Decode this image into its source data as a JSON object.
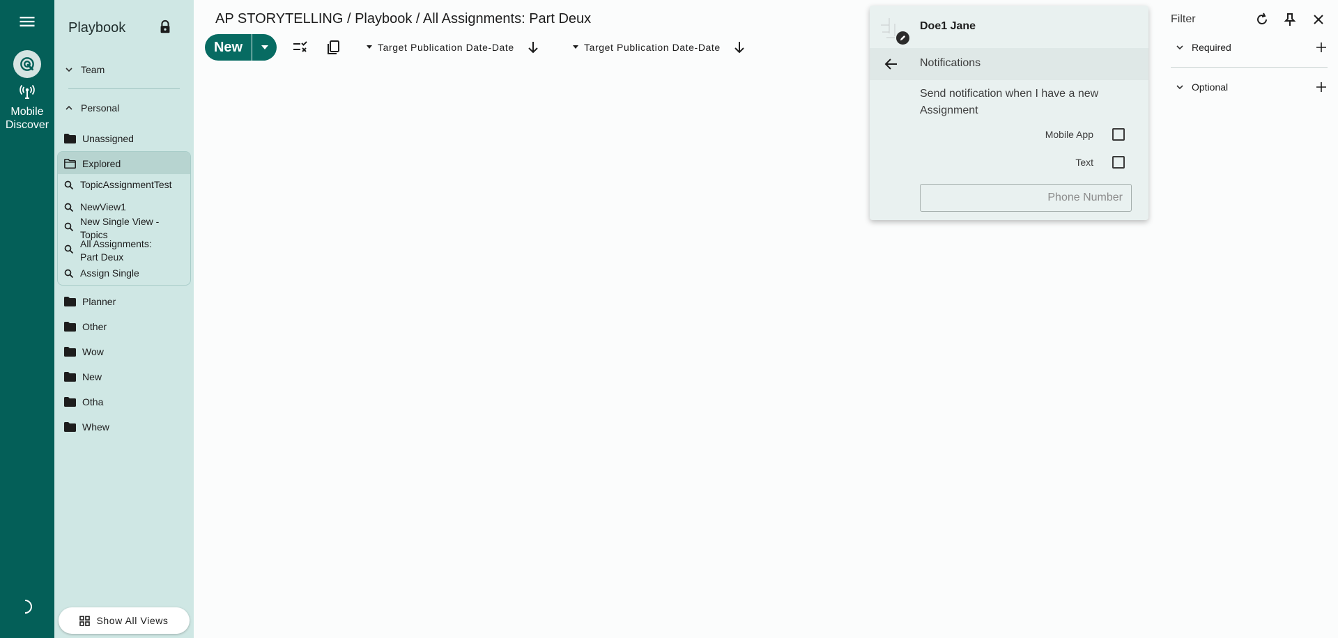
{
  "rail": {
    "label": "Mobile Discover",
    "icons": [
      "menu-icon",
      "discover-icon",
      "antenna-icon",
      "dark-mode-icon"
    ]
  },
  "sidebar": {
    "title": "Playbook",
    "sections": [
      {
        "label": "Team",
        "state": "collapsed"
      },
      {
        "label": "Personal",
        "state": "expanded"
      }
    ],
    "folders_top": [
      {
        "label": "Unassigned"
      }
    ],
    "explored": {
      "label": "Explored",
      "views": [
        {
          "label": "TopicAssignmentTest"
        },
        {
          "label": "NewView1"
        },
        {
          "label": "New Single View - Topics"
        },
        {
          "label": "All Assignments: Part Deux"
        },
        {
          "label": "Assign Single"
        }
      ]
    },
    "folders_bottom": [
      {
        "label": "Planner"
      },
      {
        "label": "Other"
      },
      {
        "label": "Wow"
      },
      {
        "label": "New"
      },
      {
        "label": "Otha"
      },
      {
        "label": "Whew"
      }
    ],
    "show_all": "Show All Views"
  },
  "header": {
    "breadcrumb": "AP STORYTELLING / Playbook / All Assignments: Part Deux",
    "new_label": "New",
    "sorts": [
      {
        "label": "Target Publication Date-Date",
        "direction": "descending"
      },
      {
        "label": "Target Publication Date-Date",
        "direction": "descending"
      }
    ]
  },
  "popup": {
    "user_name": "Doe1 Jane",
    "title": "Notifications",
    "description": "Send notification when I have a new Assignment",
    "options": [
      {
        "label": "Mobile App",
        "checked": false
      },
      {
        "label": "Text",
        "checked": false
      }
    ],
    "phone_placeholder": "Phone Number"
  },
  "filter": {
    "title": "Filter",
    "groups": [
      {
        "label": "Required"
      },
      {
        "label": "Optional"
      }
    ]
  },
  "colors": {
    "rail": "#045f58",
    "sidebar": "#cfe7e4",
    "accent": "#076b62",
    "popup": "#e9f1f0"
  }
}
